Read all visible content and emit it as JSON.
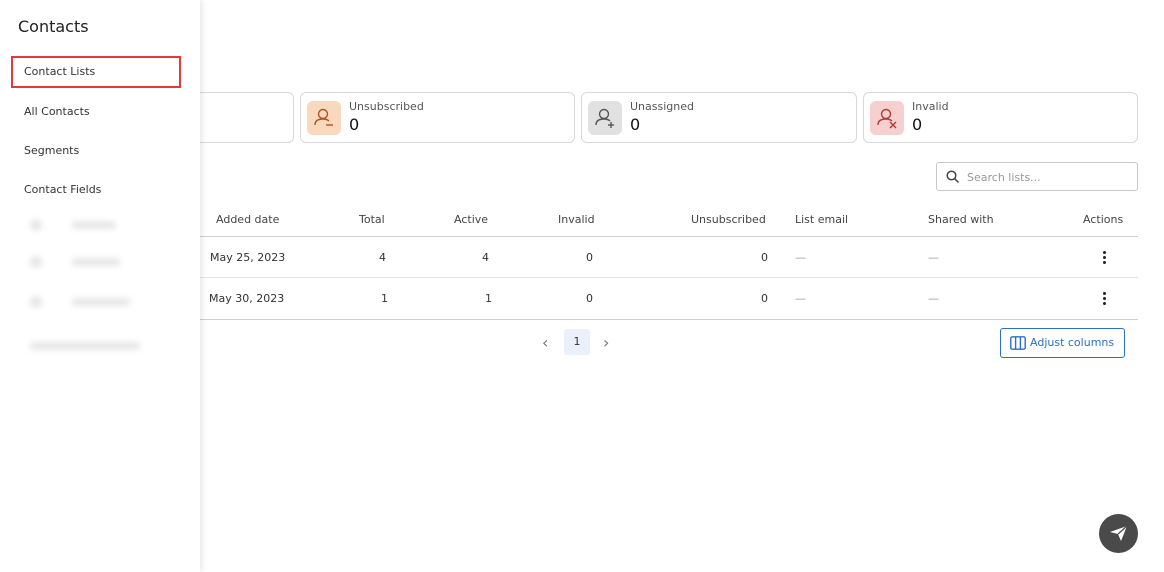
{
  "sidebar": {
    "title": "Contacts",
    "items": [
      {
        "label": "Contact Lists",
        "active": true
      },
      {
        "label": "All Contacts"
      },
      {
        "label": "Segments"
      },
      {
        "label": "Contact Fields"
      }
    ]
  },
  "stats": [
    {
      "label": "Unsubscribed",
      "value": "0",
      "icon": "user-minus-icon",
      "color": "#f9d9bd"
    },
    {
      "label": "Unassigned",
      "value": "0",
      "icon": "user-plus-icon",
      "color": "#e1e1e1"
    },
    {
      "label": "Invalid",
      "value": "0",
      "icon": "user-x-icon",
      "color": "#f6cfcf"
    }
  ],
  "search": {
    "placeholder": "Search lists..."
  },
  "table": {
    "columns": [
      "Added date",
      "Total",
      "Active",
      "Invalid",
      "Unsubscribed",
      "List email",
      "Shared with",
      "Actions"
    ],
    "rows": [
      {
        "added": "May 25, 2023",
        "total": "4",
        "active": "4",
        "invalid": "0",
        "unsubscribed": "0",
        "list_email": "—",
        "shared_with": "—"
      },
      {
        "added": "May 30, 2023",
        "total": "1",
        "active": "1",
        "invalid": "0",
        "unsubscribed": "0",
        "list_email": "—",
        "shared_with": "—"
      }
    ]
  },
  "pagination": {
    "current": "1",
    "prev": "‹",
    "next": "›"
  },
  "adjust_columns_label": "Adjust columns",
  "icons": {
    "search": "search-icon",
    "columns": "columns-icon",
    "chat": "send-icon"
  }
}
